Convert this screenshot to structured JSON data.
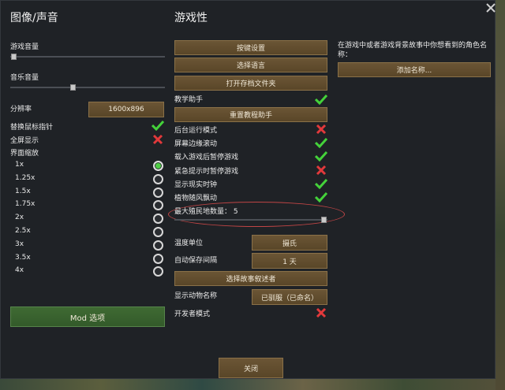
{
  "left": {
    "title": "图像/声音",
    "game_volume": "游戏音量",
    "music_volume": "音乐音量",
    "resolution_label": "分辨率",
    "resolution_value": "1600x896",
    "custom_cursor": "替换鼠标指针",
    "fullscreen": "全屏显示",
    "ui_scale": "界面缩放",
    "scales": [
      "1x",
      "1.25x",
      "1.5x",
      "1.75x",
      "2x",
      "2.5x",
      "3x",
      "3.5x",
      "4x"
    ],
    "selected_scale": "1x",
    "mod_button": "Mod 选项"
  },
  "middle": {
    "title": "游戏性",
    "keybindings": "按键设置",
    "choose_language": "选择语言",
    "open_save_folder": "打开存档文件夹",
    "tutor": "教学助手",
    "reset_tutor": "重置教程助手",
    "toggles": [
      {
        "label": "后台运行模式",
        "on": false
      },
      {
        "label": "屏幕边缘滚动",
        "on": true
      },
      {
        "label": "载入游戏后暂停游戏",
        "on": true
      },
      {
        "label": "紧急提示时暂停游戏",
        "on": false
      },
      {
        "label": "显示现实时钟",
        "on": true
      },
      {
        "label": "植物随风飘动",
        "on": true
      }
    ],
    "max_colonies": "最大殖民地数量： 5",
    "temp_unit_label": "温度单位",
    "temp_unit_value": "摄氏",
    "autosave_label": "自动保存间隔",
    "autosave_value": "1 天",
    "choose_storyteller": "选择故事叙述者",
    "animal_names_label": "显示动物名称",
    "animal_names_value": "已驯服（已命名）",
    "dev_mode": "开发者模式",
    "dev_mode_on": false,
    "close": "关闭"
  },
  "right": {
    "names_desc": "在游戏中或者游戏背景故事中你想看到的角色名称：",
    "add_name": "添加名称..."
  },
  "colors": {
    "check": "#44d23a",
    "cross": "#e2393b",
    "highlight": "#c04545"
  }
}
